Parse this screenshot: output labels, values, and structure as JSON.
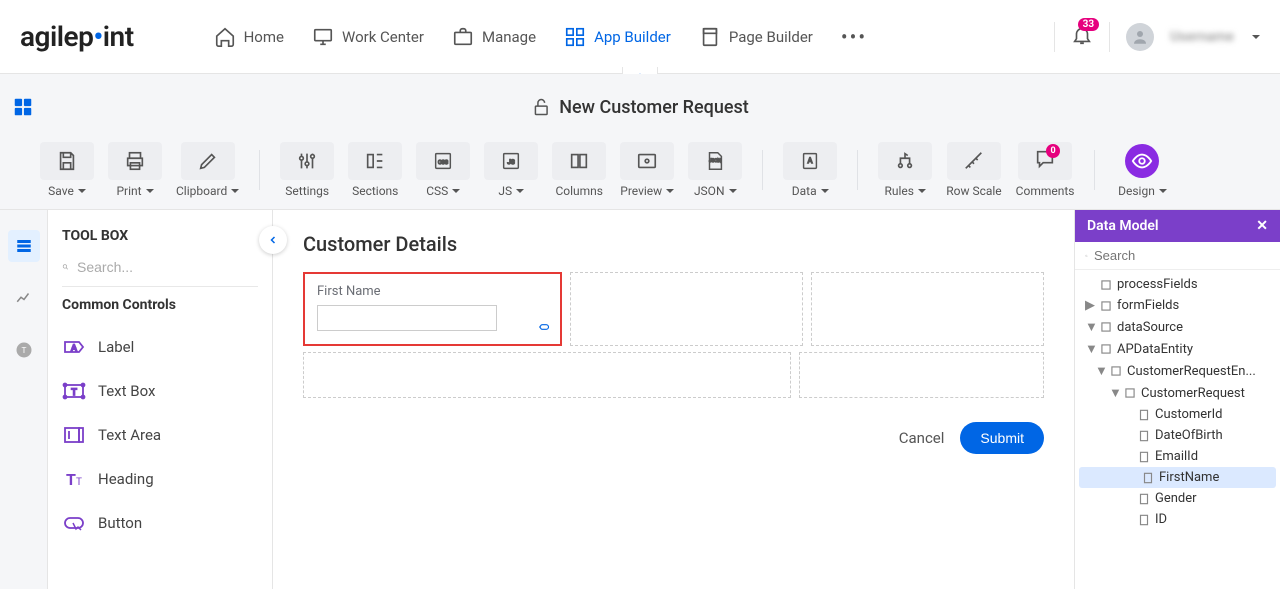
{
  "nav": {
    "logo_pre": "agilep",
    "logo_post": "int",
    "home": "Home",
    "work_center": "Work Center",
    "manage": "Manage",
    "app_builder": "App Builder",
    "page_builder": "Page Builder",
    "notif_count": "33",
    "user_name": "Username"
  },
  "secondary": {
    "title": "New Customer Request"
  },
  "toolbar": {
    "save": "Save",
    "print": "Print",
    "clipboard": "Clipboard",
    "settings": "Settings",
    "sections": "Sections",
    "css": "CSS",
    "js": "JS",
    "columns": "Columns",
    "preview": "Preview",
    "json": "JSON",
    "data": "Data",
    "rules": "Rules",
    "row_scale": "Row Scale",
    "comments": "Comments",
    "comments_badge": "0",
    "design": "Design"
  },
  "toolbox": {
    "title": "TOOL BOX",
    "search_placeholder": "Search...",
    "group": "Common Controls",
    "items": {
      "label": "Label",
      "textbox": "Text Box",
      "textarea": "Text Area",
      "heading": "Heading",
      "button": "Button"
    }
  },
  "canvas": {
    "section_title": "Customer Details",
    "field_label": "First Name",
    "cancel": "Cancel",
    "submit": "Submit"
  },
  "datamodel": {
    "title": "Data Model",
    "search_placeholder": "Search",
    "nodes": {
      "processFields": "processFields",
      "formFields": "formFields",
      "dataSource": "dataSource",
      "APDataEntity": "APDataEntity",
      "CustomerRequestEn": "CustomerRequestEn...",
      "CustomerRequest": "CustomerRequest",
      "CustomerId": "CustomerId",
      "DateOfBirth": "DateOfBirth",
      "EmailId": "EmailId",
      "FirstName": "FirstName",
      "Gender": "Gender",
      "ID": "ID"
    }
  }
}
